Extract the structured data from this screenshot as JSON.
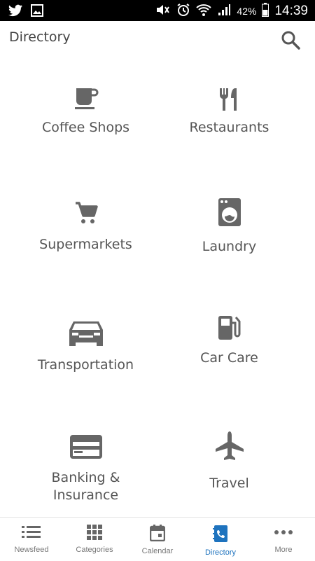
{
  "status_bar": {
    "battery_percent": "42%",
    "time": "14:39",
    "left_icons": [
      "twitter-icon",
      "image-icon"
    ],
    "right_icons": [
      "mute-icon",
      "alarm-icon",
      "wifi-icon",
      "signal-icon",
      "battery-icon"
    ]
  },
  "header": {
    "title": "Directory",
    "search_icon": "search-icon"
  },
  "categories": [
    {
      "label": "Coffee Shops",
      "icon": "coffee-icon"
    },
    {
      "label": "Restaurants",
      "icon": "restaurant-icon"
    },
    {
      "label": "Supermarkets",
      "icon": "cart-icon"
    },
    {
      "label": "Laundry",
      "icon": "laundry-icon"
    },
    {
      "label": "Transportation",
      "icon": "car-icon"
    },
    {
      "label": "Car Care",
      "icon": "fuel-icon"
    },
    {
      "label": "Banking &\nInsurance",
      "icon": "credit-card-icon"
    },
    {
      "label": "Travel",
      "icon": "airplane-icon"
    }
  ],
  "bottom_nav": {
    "active": "Directory",
    "active_color": "#1e73be",
    "items": [
      {
        "label": "Newsfeed",
        "icon": "list-icon"
      },
      {
        "label": "Categories",
        "icon": "grid-icon"
      },
      {
        "label": "Calendar",
        "icon": "calendar-icon"
      },
      {
        "label": "Directory",
        "icon": "contacts-book-icon"
      },
      {
        "label": "More",
        "icon": "more-icon"
      }
    ]
  }
}
